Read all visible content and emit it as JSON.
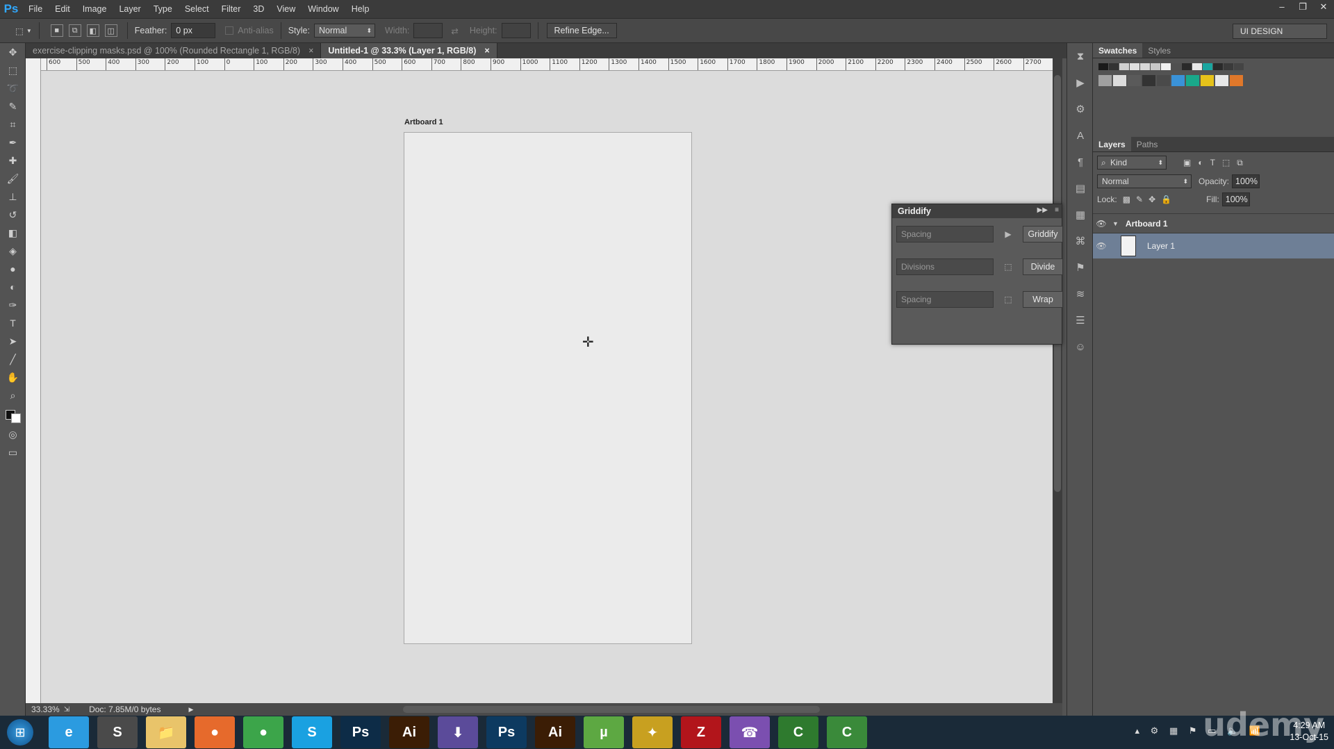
{
  "menubar": {
    "logo": "Ps",
    "items": [
      "File",
      "Edit",
      "Image",
      "Layer",
      "Type",
      "Select",
      "Filter",
      "3D",
      "View",
      "Window",
      "Help"
    ]
  },
  "options_bar": {
    "feather_label": "Feather:",
    "feather_value": "0 px",
    "antialias_label": "Anti-alias",
    "style_label": "Style:",
    "style_value": "Normal",
    "width_label": "Width:",
    "height_label": "Height:",
    "refine_edge": "Refine Edge...",
    "workspace": "UI DESIGN"
  },
  "tabs": [
    {
      "label": "exercise-clipping masks.psd @ 100% (Rounded Rectangle 1, RGB/8)",
      "close": "×",
      "active": false
    },
    {
      "label": "Untitled-1 @ 33.3% (Layer 1, RGB/8)",
      "close": "×",
      "active": true
    }
  ],
  "ruler_ticks": [
    "600",
    "500",
    "400",
    "300",
    "200",
    "100",
    "0",
    "100",
    "200",
    "300",
    "400",
    "500",
    "600",
    "700",
    "800",
    "900",
    "1000",
    "1100",
    "1200",
    "1300",
    "1400",
    "1500",
    "1600",
    "1700",
    "1800",
    "1900",
    "2000",
    "2100",
    "2200",
    "2300",
    "2400",
    "2500",
    "2600",
    "2700"
  ],
  "canvas": {
    "artboard_label": "Artboard 1"
  },
  "status": {
    "zoom": "33.33%",
    "doc": "Doc: 7.85M/0 bytes"
  },
  "swatches_panel": {
    "tabs": [
      "Swatches",
      "Styles"
    ],
    "row1": [
      "#1a1a1a",
      "#333333",
      "#d0d0d0",
      "#e0e0e0",
      "#d9d9d9",
      "#c8c8c8",
      "#f0f0f0",
      "#505050",
      "#2a2a2a",
      "#e8e8e8",
      "#1aa6a0",
      "#2a2a2a",
      "#3a3a3a",
      "#444444"
    ],
    "row2": [
      "#a0a0a0",
      "#dcdcdc",
      "#5a5a5a",
      "#333333",
      "#4a4a4a",
      "#3a92d8",
      "#19a88a",
      "#e6c21a",
      "#e8e8e8",
      "#e0782a"
    ]
  },
  "layers_panel": {
    "tabs": [
      "Layers",
      "Paths"
    ],
    "filter": "Kind",
    "blend_mode": "Normal",
    "opacity_label": "Opacity:",
    "opacity_value": "100%",
    "lock_label": "Lock:",
    "fill_label": "Fill:",
    "fill_value": "100%",
    "layers": [
      {
        "name": "Artboard 1",
        "type": "artboard"
      },
      {
        "name": "Layer 1",
        "type": "layer",
        "selected": true
      }
    ]
  },
  "griddify": {
    "title": "Griddify",
    "rows": [
      {
        "placeholder": "Spacing",
        "mid": "▶",
        "button": "Griddify"
      },
      {
        "placeholder": "Divisions",
        "mid": "⬚",
        "button": "Divide"
      },
      {
        "placeholder": "Spacing",
        "mid": "⬚",
        "button": "Wrap"
      }
    ]
  },
  "taskbar": {
    "apps": [
      {
        "name": "Internet Explorer",
        "glyph": "e",
        "color": "#2b9be0"
      },
      {
        "name": "Sublime Text",
        "glyph": "S",
        "color": "#4a4a4a"
      },
      {
        "name": "File Explorer",
        "glyph": "📁",
        "color": "#e9c46a"
      },
      {
        "name": "Firefox",
        "glyph": "●",
        "color": "#e66a2c"
      },
      {
        "name": "Chrome",
        "glyph": "●",
        "color": "#3ca54a"
      },
      {
        "name": "Skype",
        "glyph": "S",
        "color": "#1aa1e1"
      },
      {
        "name": "Photoshop",
        "glyph": "Ps",
        "color": "#0d2c47"
      },
      {
        "name": "Illustrator",
        "glyph": "Ai",
        "color": "#3b1d05"
      },
      {
        "name": "Download",
        "glyph": "⬇",
        "color": "#5b4b9a"
      },
      {
        "name": "Photoshop Active",
        "glyph": "Ps",
        "color": "#0d3a60"
      },
      {
        "name": "Illustrator 2",
        "glyph": "Ai",
        "color": "#3b1d05"
      },
      {
        "name": "uTorrent",
        "glyph": "µ",
        "color": "#5da842"
      },
      {
        "name": "App",
        "glyph": "✦",
        "color": "#c8a020"
      },
      {
        "name": "FileZilla",
        "glyph": "Z",
        "color": "#b2151b"
      },
      {
        "name": "Viber",
        "glyph": "☎",
        "color": "#7b4fb0"
      },
      {
        "name": "Camtasia",
        "glyph": "C",
        "color": "#2e7a2e"
      },
      {
        "name": "Camtasia 2",
        "glyph": "C",
        "color": "#3a8a3a"
      }
    ],
    "clock_time": "4:29 AM",
    "clock_date": "13-Oct-15"
  },
  "watermark": "udemy"
}
